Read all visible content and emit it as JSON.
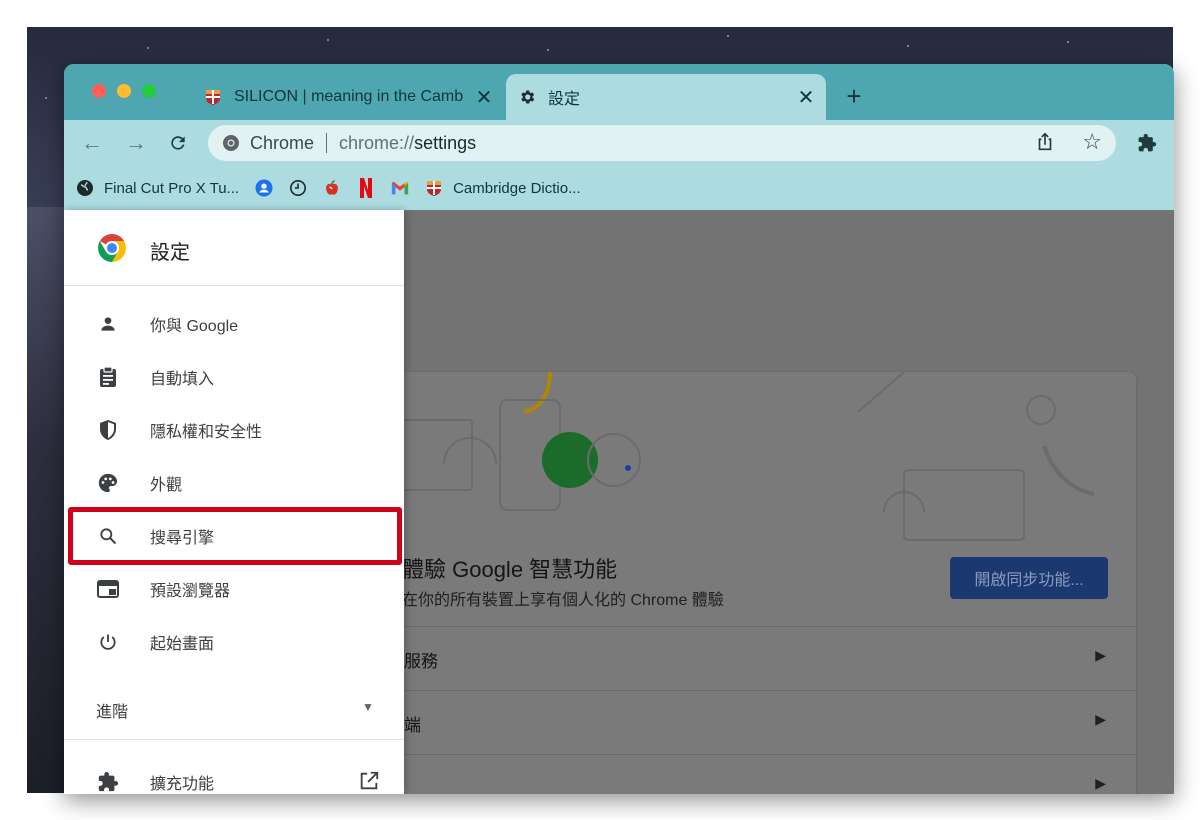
{
  "tabs": [
    {
      "title": "SILICON | meaning in the Camb",
      "active": false
    },
    {
      "title": "設定",
      "active": true
    }
  ],
  "toolbar": {
    "omnibox_site": "Chrome",
    "omnibox_scheme": "chrome://",
    "omnibox_path": "settings"
  },
  "bookmarks": [
    {
      "label": "Final Cut Pro X Tu...",
      "icon": "globe-icon"
    },
    {
      "label": "",
      "icon": "account-icon"
    },
    {
      "label": "",
      "icon": "clock-icon"
    },
    {
      "label": "",
      "icon": "apple-icon"
    },
    {
      "label": "",
      "icon": "netflix-icon"
    },
    {
      "label": "",
      "icon": "gmail-icon"
    },
    {
      "label": "Cambridge Dictio...",
      "icon": "cambridge-icon"
    }
  ],
  "drawer": {
    "title": "設定",
    "items": [
      {
        "label": "你與 Google",
        "icon": "person-icon"
      },
      {
        "label": "自動填入",
        "icon": "clipboard-icon"
      },
      {
        "label": "隱私權和安全性",
        "icon": "shield-icon"
      },
      {
        "label": "外觀",
        "icon": "palette-icon"
      },
      {
        "label": "搜尋引擎",
        "icon": "search-icon"
      },
      {
        "label": "預設瀏覽器",
        "icon": "browser-icon"
      },
      {
        "label": "起始畫面",
        "icon": "power-icon"
      }
    ],
    "advanced_label": "進階",
    "extensions_label": "擴充功能"
  },
  "main": {
    "promo_title": "體驗 Google 智慧功能",
    "promo_sub": "在你的所有裝置上享有個人化的 Chrome 體驗",
    "sync_button": "開啟同步功能...",
    "rows": [
      "服務",
      "端",
      ""
    ]
  },
  "colors": {
    "tabstrip": "#4ea7b0",
    "toolbar": "#acdcdf",
    "highlight": "#d0021b",
    "sync_button": "#1b3870"
  }
}
